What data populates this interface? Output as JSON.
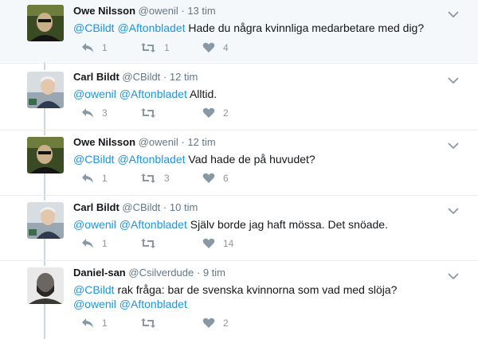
{
  "tweets": [
    {
      "name": "Owe Nilsson",
      "handle": "@owenil",
      "sep": "·",
      "time": "13 tim",
      "segments": [
        {
          "t": "@CBildt",
          "m": true
        },
        {
          "t": " ",
          "m": false
        },
        {
          "t": "@Aftonbladet",
          "m": true
        },
        {
          "t": " Hade du några kvinnliga medarbetare med dig?",
          "m": false
        }
      ],
      "replies": "1",
      "retweets": "1",
      "likes": "4"
    },
    {
      "name": "Carl Bildt",
      "handle": "@CBildt",
      "sep": "·",
      "time": "12 tim",
      "segments": [
        {
          "t": "@owenil",
          "m": true
        },
        {
          "t": " ",
          "m": false
        },
        {
          "t": "@Aftonbladet",
          "m": true
        },
        {
          "t": " Alltid.",
          "m": false
        }
      ],
      "replies": "3",
      "retweets": "",
      "likes": "2"
    },
    {
      "name": "Owe Nilsson",
      "handle": "@owenil",
      "sep": "·",
      "time": "12 tim",
      "segments": [
        {
          "t": "@CBildt",
          "m": true
        },
        {
          "t": " ",
          "m": false
        },
        {
          "t": "@Aftonbladet",
          "m": true
        },
        {
          "t": " Vad hade de på huvudet?",
          "m": false
        }
      ],
      "replies": "1",
      "retweets": "3",
      "likes": "6"
    },
    {
      "name": "Carl Bildt",
      "handle": "@CBildt",
      "sep": "·",
      "time": "10 tim",
      "segments": [
        {
          "t": "@owenil",
          "m": true
        },
        {
          "t": " ",
          "m": false
        },
        {
          "t": "@Aftonbladet",
          "m": true
        },
        {
          "t": " Själv borde jag haft mössa. Det snöade.",
          "m": false
        }
      ],
      "replies": "1",
      "retweets": "",
      "likes": "14"
    },
    {
      "name": "Daniel-san",
      "handle": "@Csilverdude",
      "sep": "·",
      "time": "9 tim",
      "segments": [
        {
          "t": "@CBildt",
          "m": true
        },
        {
          "t": " rak fråga: bar de svenska kvinnorna som vad med slöja?",
          "m": false
        },
        {
          "br": true
        },
        {
          "t": "@owenil",
          "m": true
        },
        {
          "t": " ",
          "m": false
        },
        {
          "t": "@Aftonbladet",
          "m": true
        }
      ],
      "replies": "1",
      "retweets": "",
      "likes": "2"
    }
  ],
  "colors": {
    "mention": "#1b95e0",
    "action": "#8899a6",
    "thread_line": "#ccd6dd",
    "highlight_bg": "#f5f8fa"
  },
  "icons": {
    "reply": "reply-icon",
    "retweet": "retweet-icon",
    "like": "heart-icon",
    "caret": "chevron-down-icon"
  }
}
